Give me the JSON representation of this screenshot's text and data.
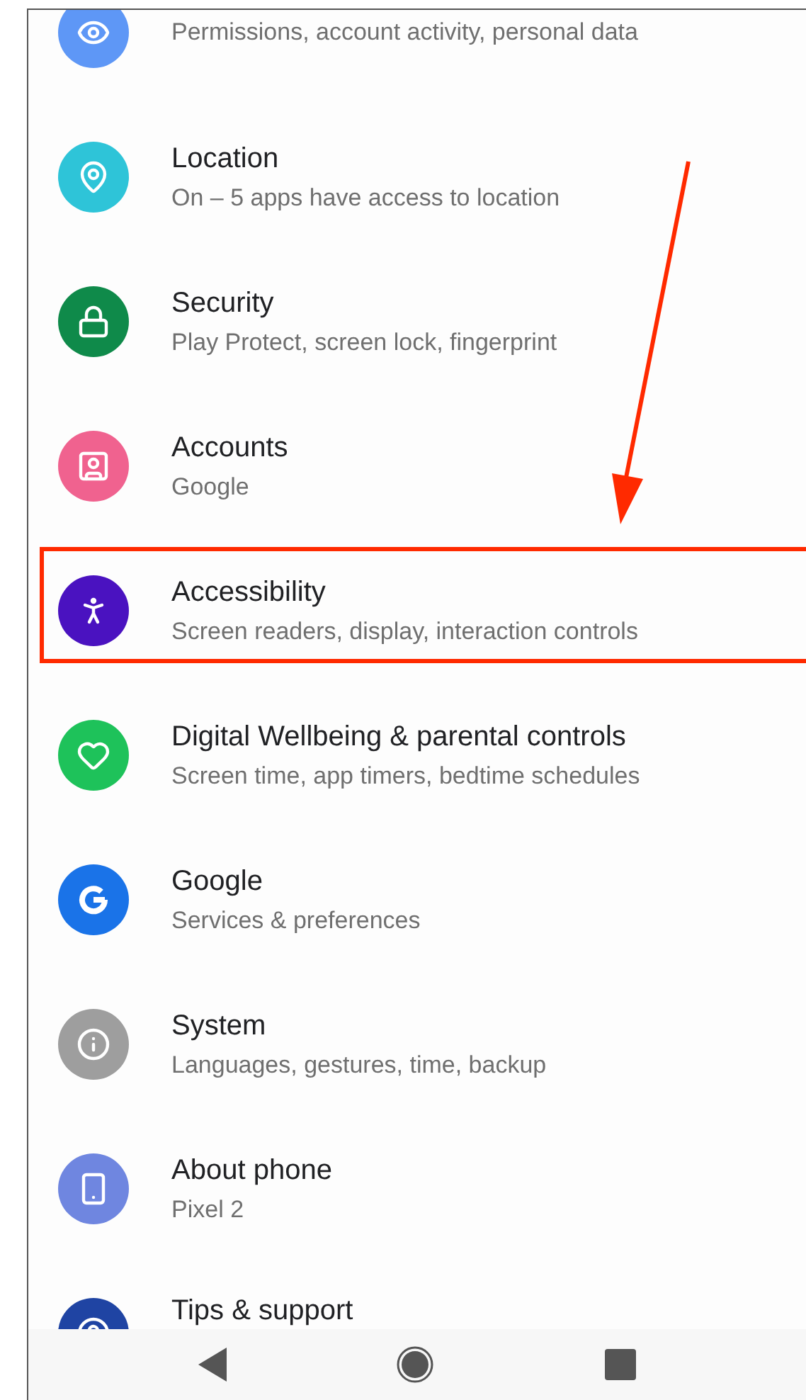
{
  "settings": [
    {
      "kind": "privacy",
      "color": "#5e97f6",
      "subtitle": "Permissions, account activity, personal data",
      "highlighted": false
    },
    {
      "kind": "location",
      "color": "#2ec4d8",
      "title": "Location",
      "subtitle": "On – 5 apps have access to location",
      "highlighted": false
    },
    {
      "kind": "security",
      "color": "#0f8a4a",
      "title": "Security",
      "subtitle": "Play Protect, screen lock, fingerprint",
      "highlighted": false
    },
    {
      "kind": "accounts",
      "color": "#f0628f",
      "title": "Accounts",
      "subtitle": "Google",
      "highlighted": false
    },
    {
      "kind": "accessibility",
      "color": "#4a12c0",
      "title": "Accessibility",
      "subtitle": "Screen readers, display, interaction controls",
      "highlighted": true
    },
    {
      "kind": "wellbeing",
      "color": "#1ec25a",
      "title": "Digital Wellbeing & parental controls",
      "subtitle": "Screen time, app timers, bedtime schedules",
      "highlighted": false
    },
    {
      "kind": "google",
      "color": "#1a73e8",
      "title": "Google",
      "subtitle": "Services & preferences",
      "highlighted": false
    },
    {
      "kind": "system",
      "color": "#9e9e9e",
      "title": "System",
      "subtitle": "Languages, gestures, time, backup",
      "highlighted": false
    },
    {
      "kind": "about",
      "color": "#6f86e0",
      "title": "About phone",
      "subtitle": "Pixel 2",
      "highlighted": false
    },
    {
      "kind": "tips",
      "color": "#1f44a3",
      "title": "Tips & support",
      "highlighted": false
    }
  ]
}
